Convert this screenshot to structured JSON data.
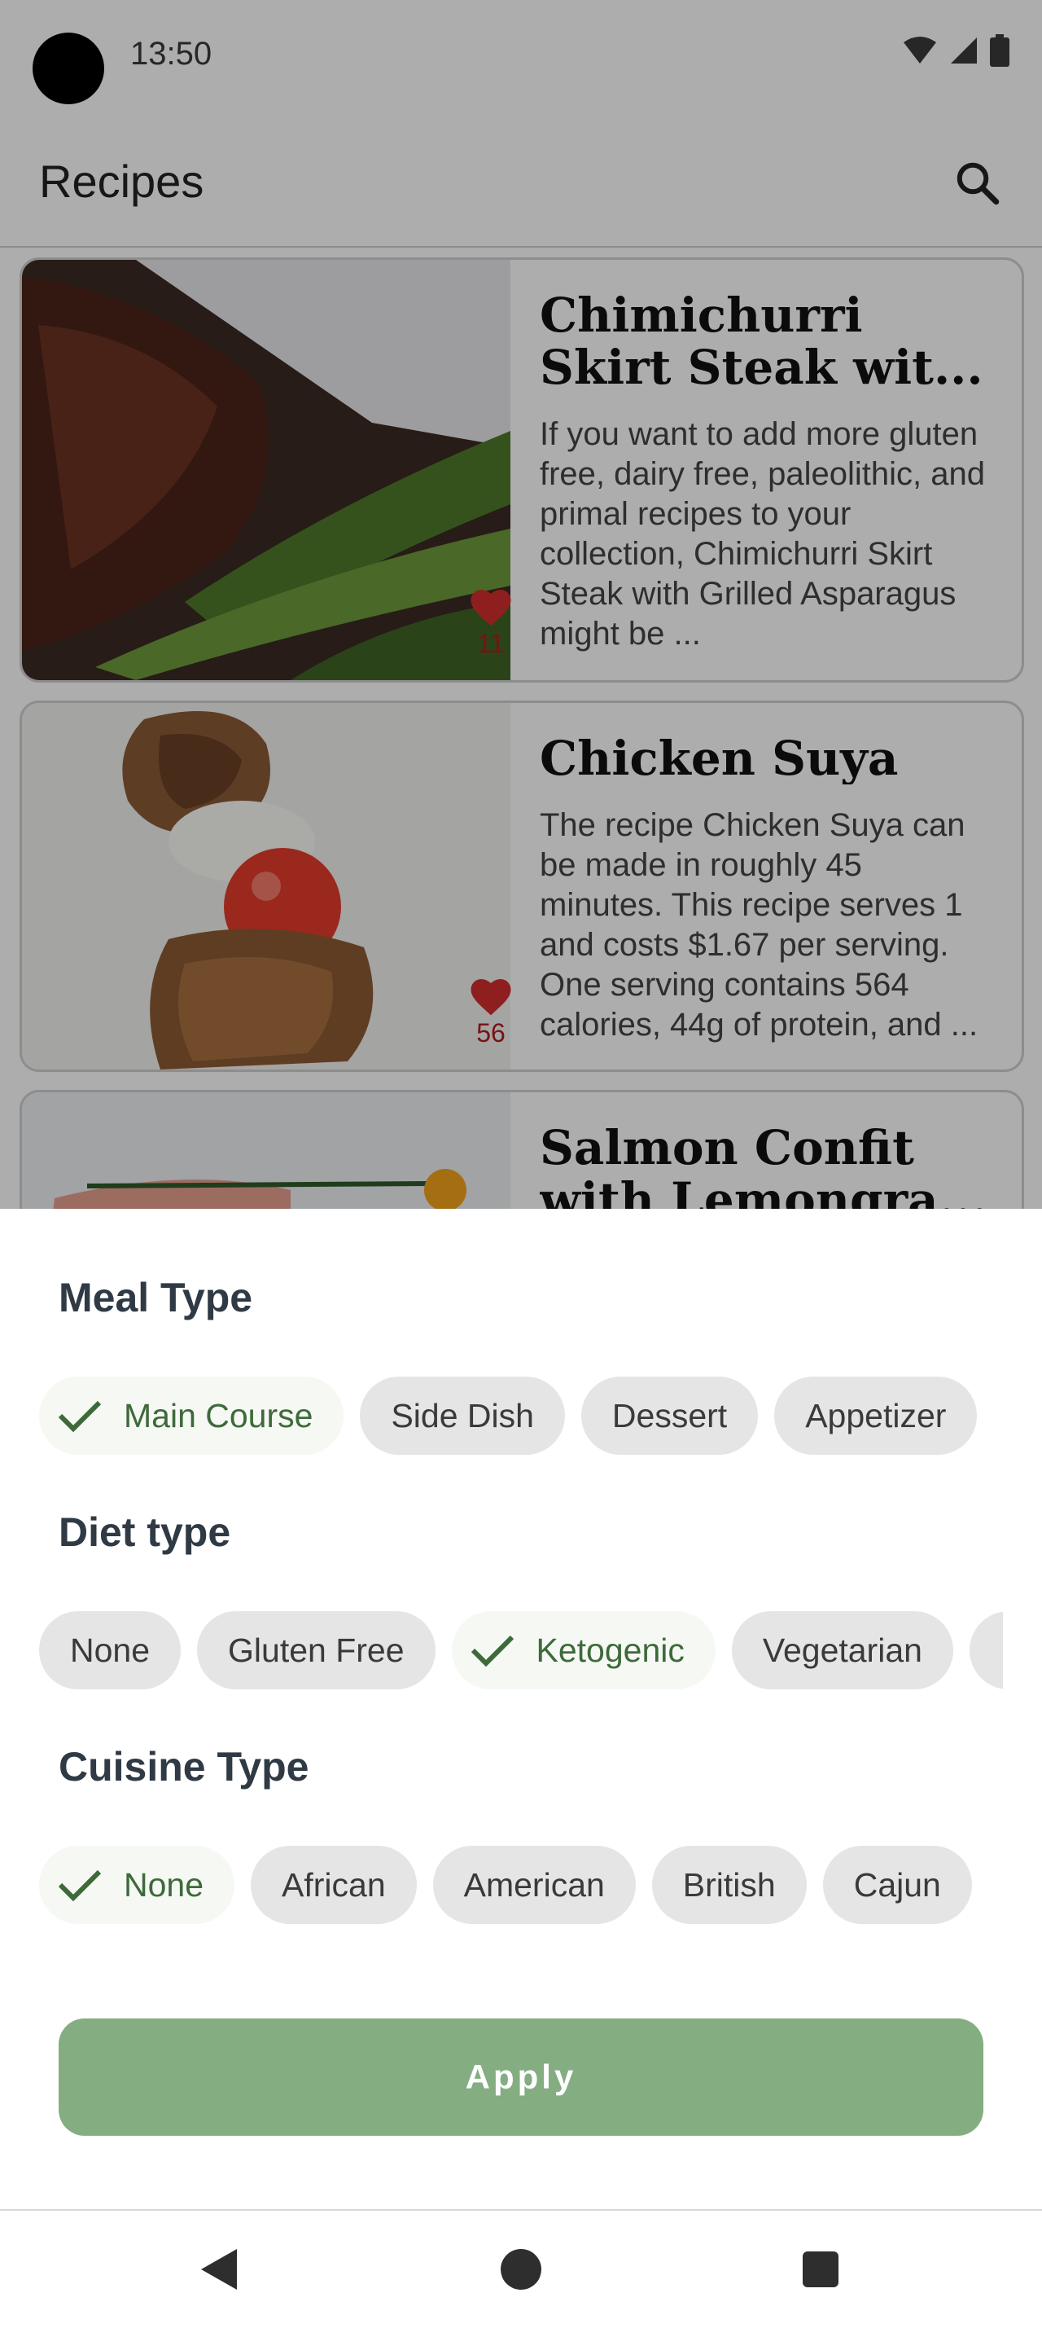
{
  "status_bar": {
    "time": "13:50",
    "icons": [
      "wifi-icon",
      "signal-icon",
      "battery-icon"
    ]
  },
  "app_bar": {
    "title": "Recipes",
    "search_icon": "search-icon"
  },
  "recipes": [
    {
      "title": "Chimichurri Skirt Steak wit...",
      "description": "If you want to add more gluten free, dairy free, paleolithic, and primal recipes to your collection, Chimichurri Skirt Steak with Grilled Asparagus might be ...",
      "likes": "11"
    },
    {
      "title": "Chicken Suya",
      "description": "The recipe Chicken Suya can be made in roughly 45 minutes. This recipe serves 1 and costs $1.67 per serving. One serving contains 564 calories, 44g of protein, and ...",
      "likes": "56"
    },
    {
      "title": "Salmon Confit with Lemongra...",
      "description": "",
      "likes": ""
    }
  ],
  "filter_sheet": {
    "meal_type": {
      "title": "Meal Type",
      "chips": [
        {
          "label": "Main Course",
          "selected": true
        },
        {
          "label": "Side Dish",
          "selected": false
        },
        {
          "label": "Dessert",
          "selected": false
        },
        {
          "label": "Appetizer",
          "selected": false
        }
      ]
    },
    "diet_type": {
      "title": "Diet type",
      "chips": [
        {
          "label": "None",
          "selected": false
        },
        {
          "label": "Gluten Free",
          "selected": false
        },
        {
          "label": "Ketogenic",
          "selected": true
        },
        {
          "label": "Vegetarian",
          "selected": false
        }
      ]
    },
    "cuisine_type": {
      "title": "Cuisine Type",
      "chips": [
        {
          "label": "None",
          "selected": true
        },
        {
          "label": "African",
          "selected": false
        },
        {
          "label": "American",
          "selected": false
        },
        {
          "label": "British",
          "selected": false
        },
        {
          "label": "Cajun",
          "selected": false
        }
      ]
    },
    "apply_label": "Apply"
  },
  "colors": {
    "accent_green": "#84ad82",
    "selected_text": "#3e6a3a",
    "favorite_red": "#d32f2f"
  },
  "nav_bar": {
    "icons": [
      "back-icon",
      "home-icon",
      "recents-icon"
    ]
  }
}
